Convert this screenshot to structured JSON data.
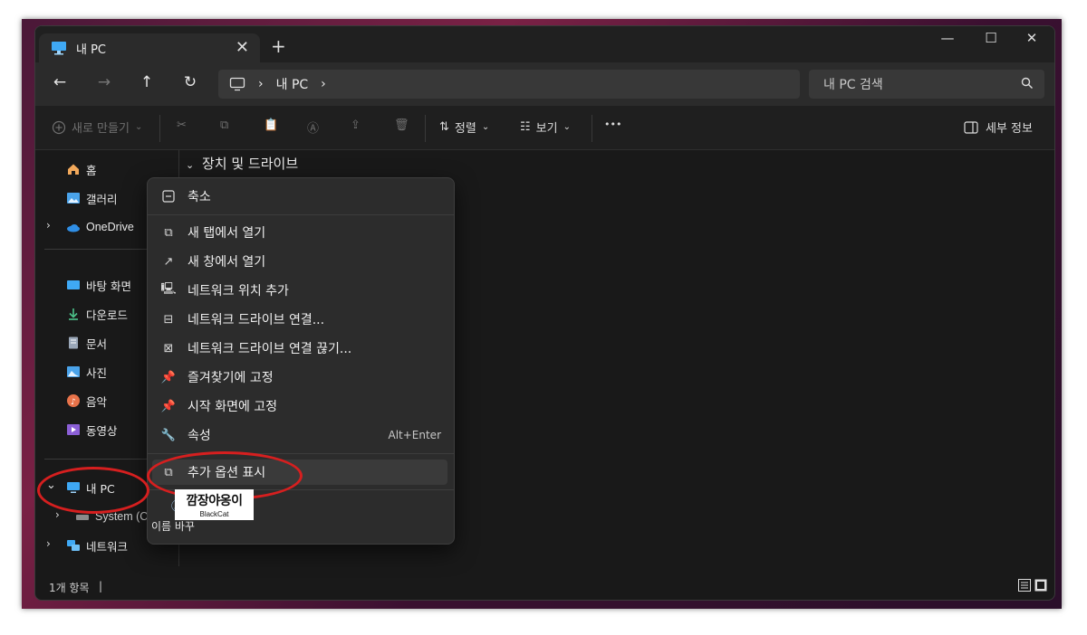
{
  "tab": {
    "title": "내 PC",
    "close": "✕",
    "new_tab": "+"
  },
  "window_controls": {
    "minimize": "—",
    "maximize": "☐",
    "close": "✕"
  },
  "nav": {
    "back": "←",
    "forward": "→",
    "up": "↑",
    "refresh": "↻"
  },
  "address": {
    "sep1": "›",
    "location": "내 PC",
    "sep2": "›"
  },
  "search": {
    "placeholder": "내 PC 검색"
  },
  "toolbar": {
    "new_label": "새로 만들기",
    "sort_label": "정렬",
    "view_label": "보기",
    "more": "•••",
    "details_label": "세부 정보"
  },
  "sidebar": {
    "home": "홈",
    "gallery": "갤러리",
    "onedrive": "OneDrive",
    "desktop": "바탕 화면",
    "downloads": "다운로드",
    "documents": "문서",
    "pictures": "사진",
    "music": "음악",
    "videos": "동영상",
    "this_pc": "내 PC",
    "system_drive": "System (C:",
    "network": "네트워크"
  },
  "content": {
    "section_title": "장치 및 드라이브"
  },
  "status": {
    "count": "1개 항목",
    "cursor": "|"
  },
  "context_menu": {
    "collapse": "축소",
    "open_new_tab": "새 탭에서 열기",
    "open_new_window": "새 창에서 열기",
    "add_network_location": "네트워크 위치 추가",
    "map_network_drive": "네트워크 드라이브 연결...",
    "disconnect_network_drive": "네트워크 드라이브 연결 끊기...",
    "pin_quick_access": "즐겨찾기에 고정",
    "pin_start": "시작 화면에 고정",
    "properties": "속성",
    "properties_shortcut": "Alt+Enter",
    "show_more_options": "추가 옵션 표시",
    "rename": "이름 바꾸"
  },
  "watermark": {
    "line1": "깜장야옹이",
    "line2": "BlackCat"
  },
  "colors": {
    "highlight_ring": "#d61f1f",
    "pc_icon": "#3fa9f5",
    "window_bg": "#191919"
  }
}
